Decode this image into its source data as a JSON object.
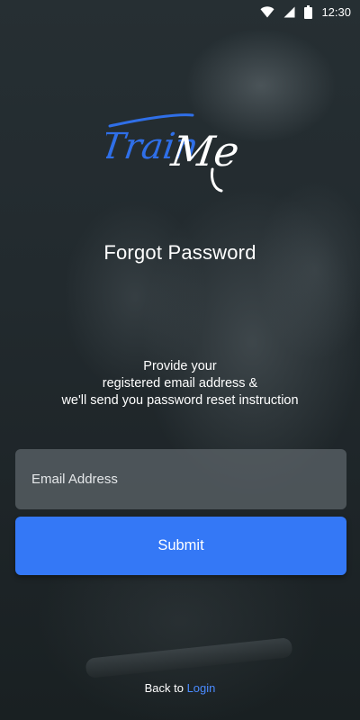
{
  "status_bar": {
    "time": "12:30",
    "icons": [
      "wifi-icon",
      "signal-icon",
      "battery-icon"
    ]
  },
  "logo": {
    "text_part1": "Train",
    "text_part2": "Me",
    "color_part1": "#2f6fe8",
    "color_part2": "#ffffff"
  },
  "page": {
    "title": "Forgot Password",
    "instructions": [
      "Provide your",
      "registered email address &",
      "we'll send you password reset instruction"
    ]
  },
  "form": {
    "email_placeholder": "Email Address",
    "email_value": "",
    "submit_label": "Submit"
  },
  "footer": {
    "back_text": "Back to",
    "login_link": "Login"
  },
  "colors": {
    "accent": "#3478f6",
    "link": "#4a8bff",
    "field_bg": "#5a6267"
  }
}
